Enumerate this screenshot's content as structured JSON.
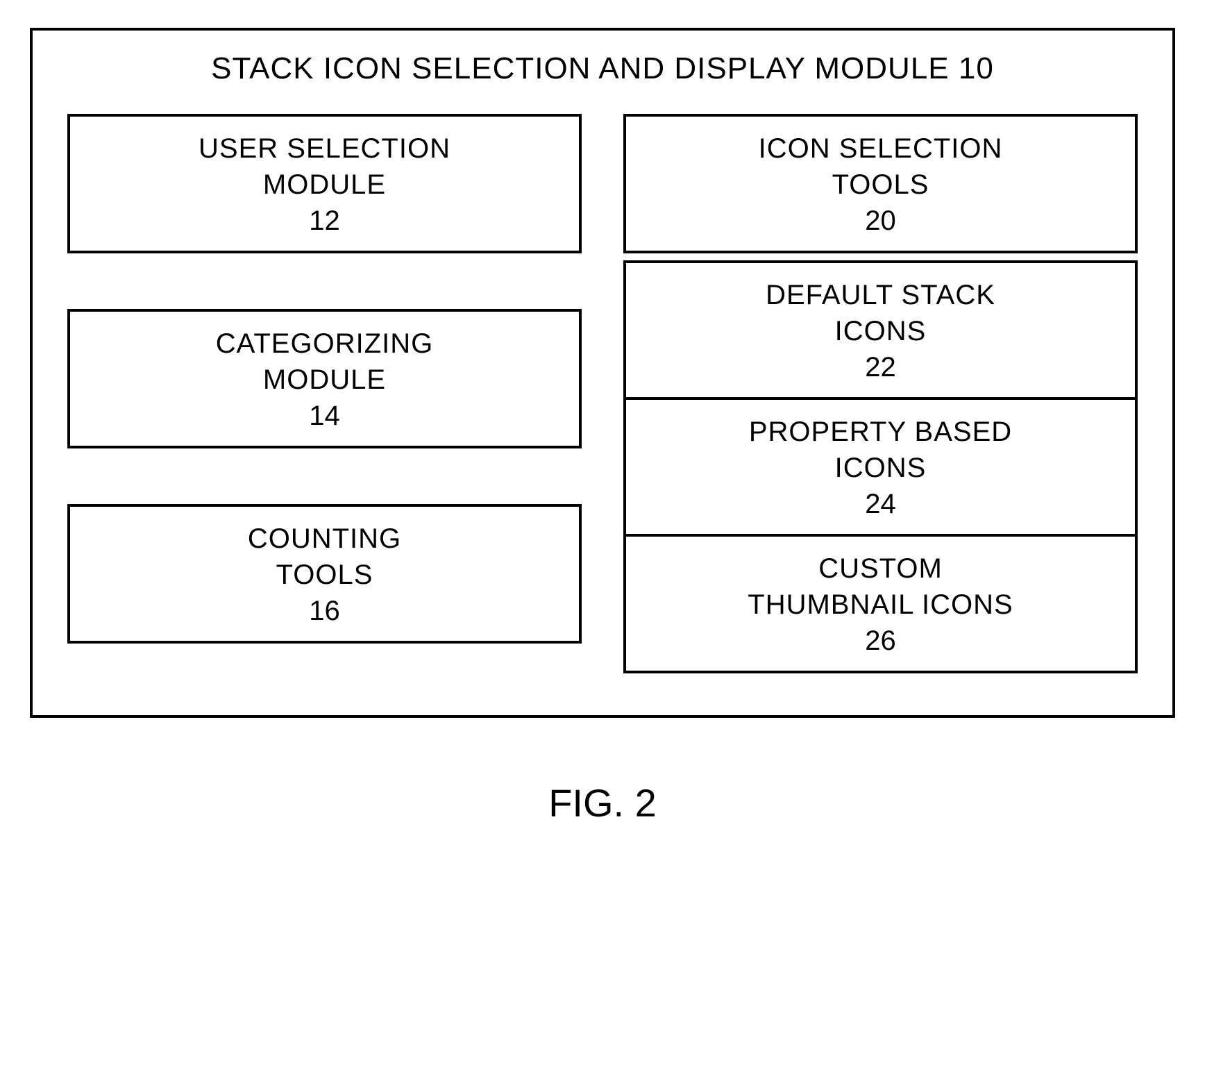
{
  "module": {
    "title": "STACK ICON SELECTION AND DISPLAY MODULE 10",
    "leftBoxes": [
      {
        "title": "USER SELECTION\nMODULE",
        "number": "12"
      },
      {
        "title": "CATEGORIZING\nMODULE",
        "number": "14"
      },
      {
        "title": "COUNTING\nTOOLS",
        "number": "16"
      }
    ],
    "rightBoxes": [
      {
        "title": "ICON SELECTION\nTOOLS",
        "number": "20"
      },
      {
        "title": "DEFAULT STACK\nICONS",
        "number": "22"
      },
      {
        "title": "PROPERTY BASED\nICONS",
        "number": "24"
      },
      {
        "title": "CUSTOM\nTHUMBNAIL ICONS",
        "number": "26"
      }
    ]
  },
  "figureLabel": "FIG. 2"
}
